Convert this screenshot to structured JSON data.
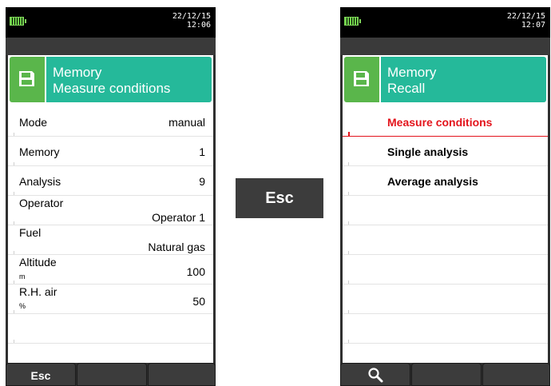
{
  "left_screen": {
    "date": "22/12/15",
    "time": "12:06",
    "header": {
      "line1": "Memory",
      "line2": "Measure conditions",
      "icon": "floppy-disk-icon"
    },
    "rows": [
      {
        "label": "Mode",
        "value": "manual"
      },
      {
        "label": "Memory",
        "value": "1"
      },
      {
        "label": "Analysis",
        "value": "9"
      },
      {
        "label": "Operator",
        "value": "Operator 1"
      },
      {
        "label": "Fuel",
        "value": "Natural gas"
      },
      {
        "label": "Altitude",
        "unit": "m",
        "value": "100"
      },
      {
        "label": "R.H. air",
        "unit": "%",
        "value": "50"
      }
    ],
    "softkeys": {
      "key1": "Esc",
      "key2": "",
      "key3": ""
    }
  },
  "center_button": {
    "label": "Esc"
  },
  "right_screen": {
    "date": "22/12/15",
    "time": "12:07",
    "header": {
      "line1": "Memory",
      "line2": "Recall",
      "icon": "floppy-disk-icon"
    },
    "menu": [
      {
        "label": "Measure conditions",
        "selected": true
      },
      {
        "label": "Single analysis",
        "selected": false
      },
      {
        "label": "Average analysis",
        "selected": false
      }
    ],
    "softkeys": {
      "key1_icon": "search-icon",
      "key2": "",
      "key3": ""
    }
  },
  "colors": {
    "header_icon_green": "#5ab64b",
    "header_title_teal": "#25b99a",
    "selected_red": "#e3141c",
    "device_dark": "#2f2f2f"
  }
}
